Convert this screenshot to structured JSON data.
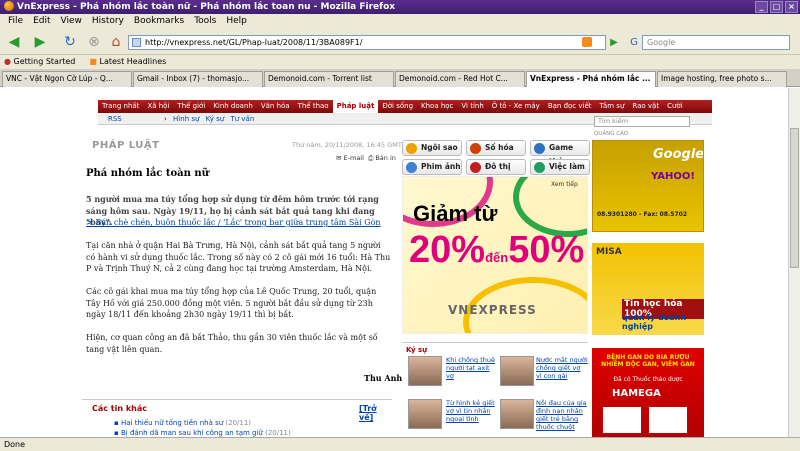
{
  "window": {
    "title": "VnExpress - Phá nhóm lắc toàn nữ - Phá nhóm lắc toan nu - Mozilla Firefox"
  },
  "menu": [
    "File",
    "Edit",
    "View",
    "History",
    "Bookmarks",
    "Tools",
    "Help"
  ],
  "nav": {
    "url": "http://vnexpress.net/GL/Phap-luat/2008/11/3BA089F1/",
    "search_placeholder": "Google"
  },
  "bookmarks": [
    "Getting Started",
    "Latest Headlines"
  ],
  "tabs": [
    {
      "label": "VNC - Vật Ngọn Cờ Lúp - Q..."
    },
    {
      "label": "Gmail - Inbox (7) - thomasjo..."
    },
    {
      "label": "Demonoid.com - Torrent list"
    },
    {
      "label": "Demonoid.com - Red Hot C..."
    },
    {
      "label": "VnExpress - Phá nhóm lắc ..."
    },
    {
      "label": "Image hosting, free photo s..."
    }
  ],
  "status": "Done",
  "site": {
    "topnav": [
      "Trang nhất",
      "Xã hội",
      "Thế giới",
      "Kinh doanh",
      "Văn hóa",
      "Thể thao",
      "Pháp luật",
      "Đời sống",
      "Khoa học",
      "Vi tính",
      "Ô tô - Xe máy",
      "Bạn đọc viết",
      "Tâm sự",
      "Rao vặt",
      "Cười"
    ],
    "subnav": {
      "rss": "RSS",
      "items": [
        "Hình sự",
        "Ký sự",
        "Tư vấn"
      ]
    },
    "search_placeholder": "Tìm kiếm",
    "section": "PHÁP LUẬT",
    "date": "Thứ năm, 20/11/2008, 16:45 GMT+7",
    "tools": {
      "email": "E-mail",
      "print": "Bản in"
    },
    "article": {
      "headline": "Phá nhóm lắc toàn nữ",
      "lead": "5 người mua ma túy tổng hợp sử dụng từ đêm hôm trước tới rạng sáng hôm sau. Ngày 19/11, họ bị cảnh sát bắt quả tang khi đang \"bay\".",
      "related1": "Bán chè chén, buôn thuốc lắc",
      "related2": "'Lắc' trong bar giữa trung tâm Sài Gòn",
      "p1": "Tại căn nhà ở quận Hai Bà Trưng, Hà Nội, cảnh sát bắt quả tang 5 người có hành vi sử dụng thuốc lắc. Trong số này có 2 cô gái mới 16 tuổi: Hà Thu P và Trịnh Thuý N, cả 2 cùng đang học tại trường Amsterdam, Hà Nội.",
      "p2": "Các cô gái khai mua ma túy tổng hợp của Lê Quốc Trung, 20 tuổi, quận Tây Hồ với giá 250.000 đồng một viên. 5 người bắt đầu sử dụng từ 23h ngày 18/11 đến khoảng 2h30 ngày 19/11 thì bị bắt.",
      "p3": "Hiện, cơ quan công an đã bắt Thảo, thu gần 30 viên thuốc lắc và một số tang vật liên quan.",
      "author": "Thu Anh"
    },
    "other": {
      "title": "Các tin khác",
      "back": "[Trở về]",
      "items": [
        {
          "t": "Hai thiếu nữ tống tiền nhà sư",
          "d": "(20/11)"
        },
        {
          "t": "Bị đánh dã man sau khi công an tạm giữ",
          "d": "(20/11)"
        }
      ]
    },
    "services": [
      {
        "label": "Ngôi sao",
        "color": "#f0a000"
      },
      {
        "label": "Số hóa",
        "color": "#d04000"
      },
      {
        "label": "Game thủ",
        "color": "#3070c0"
      },
      {
        "label": "Phim ảnh",
        "color": "#4080d0"
      },
      {
        "label": "Đô thị",
        "color": "#c02020"
      },
      {
        "label": "Việc làm",
        "color": "#20a060"
      }
    ],
    "ad": {
      "line1": "Giảm từ",
      "pct1": "20%",
      "to": "đến",
      "pct2": "50%",
      "brand": "VNEXPRESS",
      "more": "Xem tiếp"
    },
    "kysu": {
      "title": "Ký sự",
      "items": [
        "Khi chồng thuê người tạt axit vợ",
        "Nước mắt người chồng giết vợ vì con gái",
        "Từ hình kẻ giết vợ vì tin nhắn ngoại tình",
        "Nỗi đau của gia đình nạn nhân giết trẻ bằng thuốc chuột"
      ]
    },
    "qc": "QUẢNG CÁO",
    "ads_right": [
      {
        "brand": "Google",
        "extra": "YAHOO!",
        "phone": "08.9301280 - Fax: 08.5702"
      },
      {
        "brand": "MISA",
        "extra": "Tin học hóa 100%",
        "sub": "quản lý doanh nghiệp"
      },
      {
        "brand": "HAMEGA",
        "extra": "BỆNH GAN DO BIA RƯỢU NHIỄM ĐỘC GAN, VIÊM GAN",
        "sub": "Đã có Thuốc thảo dược"
      }
    ]
  }
}
